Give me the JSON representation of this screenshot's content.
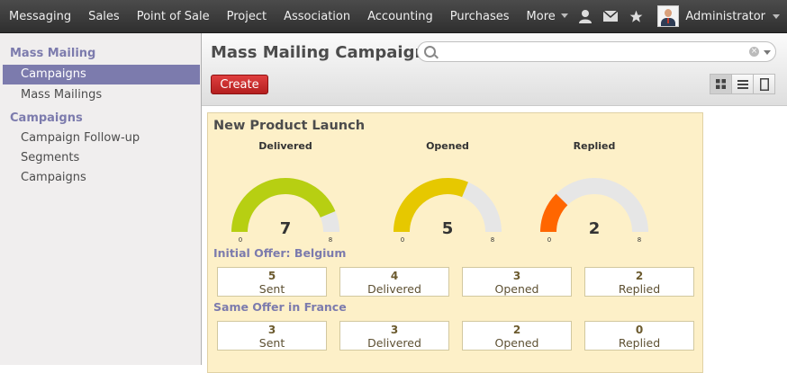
{
  "topbar": {
    "menu": [
      "Messaging",
      "Sales",
      "Point of Sale",
      "Project",
      "Association",
      "Accounting",
      "Purchases",
      "More"
    ],
    "user": "Administrator",
    "icons": [
      "user-icon",
      "mail-icon",
      "star-icon"
    ]
  },
  "sidebar": {
    "section1": "Mass Mailing",
    "items1": [
      "Campaigns",
      "Mass Mailings"
    ],
    "section2": "Campaigns",
    "items2": [
      "Campaign Follow-up",
      "Segments",
      "Campaigns"
    ]
  },
  "header": {
    "title": "Mass Mailing Campaigns",
    "search_placeholder": "",
    "create_label": "Create"
  },
  "card": {
    "title": "New Product Launch",
    "gauges": [
      {
        "label": "Delivered",
        "value": 7,
        "min": "0",
        "max": "8",
        "color": "#b7cf12"
      },
      {
        "label": "Opened",
        "value": 5,
        "min": "0",
        "max": "8",
        "color": "#e6c800"
      },
      {
        "label": "Replied",
        "value": 2,
        "min": "0",
        "max": "8",
        "color": "#ff6600"
      }
    ],
    "mailings": [
      {
        "name": "Initial Offer: Belgium",
        "stats": [
          {
            "value": "5",
            "label": "Sent"
          },
          {
            "value": "4",
            "label": "Delivered"
          },
          {
            "value": "3",
            "label": "Opened"
          },
          {
            "value": "2",
            "label": "Replied"
          }
        ]
      },
      {
        "name": "Same Offer in France",
        "stats": [
          {
            "value": "3",
            "label": "Sent"
          },
          {
            "value": "3",
            "label": "Delivered"
          },
          {
            "value": "2",
            "label": "Opened"
          },
          {
            "value": "0",
            "label": "Replied"
          }
        ]
      }
    ]
  },
  "colors": {
    "accent": "#7c7bad",
    "create": "#c32a2a",
    "card_bg": "#fdf0c8"
  }
}
